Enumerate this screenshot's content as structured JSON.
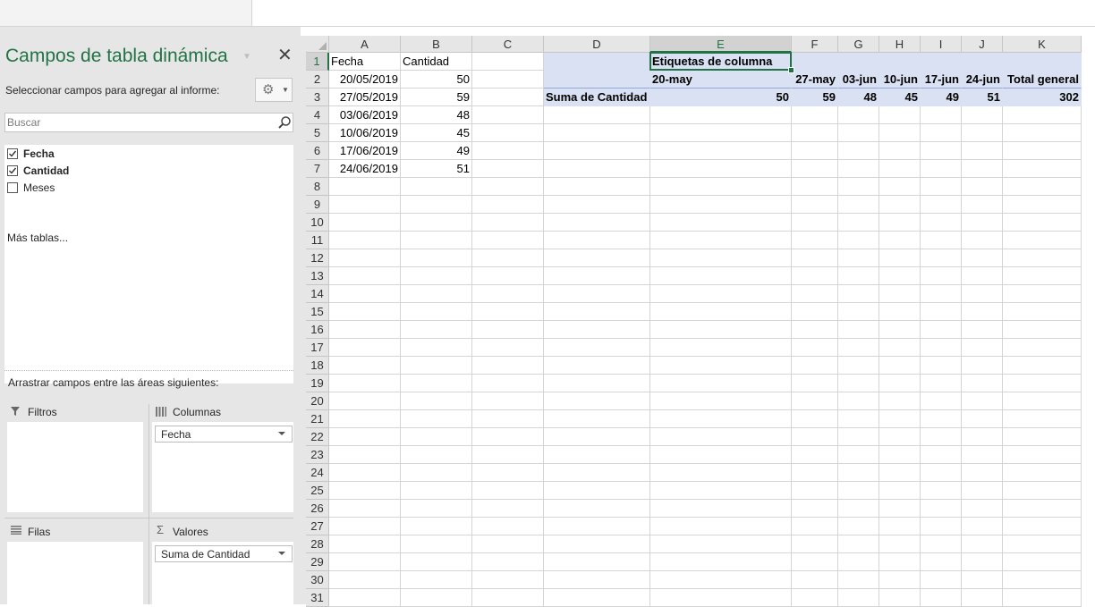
{
  "colors": {
    "accent": "#217346",
    "pivot_fill": "#d9e1f2",
    "pane_bg": "#e6e6e6"
  },
  "pane": {
    "title": "Campos de tabla dinámica",
    "close_icon": "close-icon",
    "subtitle": "Seleccionar campos para agregar al informe:",
    "search_placeholder": "Buscar",
    "fields": [
      {
        "label": "Fecha",
        "checked": true
      },
      {
        "label": "Cantidad",
        "checked": true
      },
      {
        "label": "Meses",
        "checked": false
      }
    ],
    "more_tables": "Más tablas...",
    "drag_hint": "Arrastrar campos entre las áreas siguientes:",
    "areas": {
      "filters": {
        "label": "Filtros",
        "icon": "filter-icon",
        "items": []
      },
      "columns": {
        "label": "Columnas",
        "icon": "columns-icon",
        "items": [
          "Fecha"
        ]
      },
      "rows": {
        "label": "Filas",
        "icon": "rows-icon",
        "items": []
      },
      "values": {
        "label": "Valores",
        "icon": "sigma-icon",
        "items": [
          "Suma de Cantidad"
        ]
      }
    }
  },
  "sheet": {
    "columns": [
      "A",
      "B",
      "C",
      "D",
      "E",
      "F",
      "G",
      "H",
      "I",
      "J",
      "K"
    ],
    "selected_column": "E",
    "selected_row": 1,
    "rows": [
      "1",
      "2",
      "3",
      "4",
      "5",
      "6",
      "7",
      "8",
      "9",
      "10",
      "11",
      "12",
      "13",
      "14",
      "15",
      "16",
      "17",
      "18",
      "19",
      "20",
      "21",
      "22",
      "23",
      "24",
      "25",
      "26",
      "27",
      "28",
      "29",
      "30",
      "31"
    ],
    "data": {
      "A1": "Fecha",
      "B1": "Cantidad",
      "A2": "20/05/2019",
      "B2": "50",
      "A3": "27/05/2019",
      "B3": "59",
      "A4": "03/06/2019",
      "B4": "48",
      "A5": "10/06/2019",
      "B5": "45",
      "A6": "17/06/2019",
      "B6": "49",
      "A7": "24/06/2019",
      "B7": "51"
    },
    "pivot": {
      "header": "Etiquetas de columna",
      "row_label": "Suma de Cantidad",
      "columns": [
        "20-may",
        "27-may",
        "03-jun",
        "10-jun",
        "17-jun",
        "24-jun",
        "Total general"
      ],
      "values": [
        "50",
        "59",
        "48",
        "45",
        "49",
        "51",
        "302"
      ]
    }
  }
}
